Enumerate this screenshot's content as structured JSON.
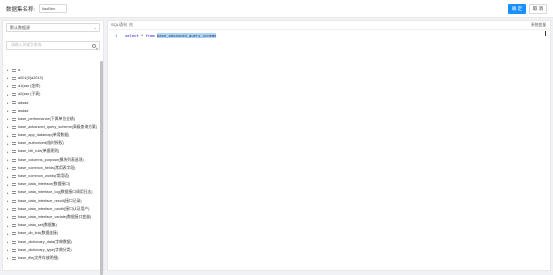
{
  "header": {
    "dataset_name_label": "数据集名称:",
    "dataset_name_value": "liaoBen",
    "confirm_label": "确 定",
    "cancel_label": "取 消"
  },
  "left_panel": {
    "database_select": "默认数据源",
    "search_placeholder": "请输入关键字查询",
    "tables": [
      "a",
      "a001(0)a2013)",
      "a1(sss (金库)",
      "a2(sss (子表)",
      "adsad",
      "asdad",
      "base_performance(下属单位业绩)",
      "base_advanced_query_scheme(高级查询方案)",
      "base_app_datamap(单用数据)",
      "base_authorized(临时授权)",
      "base_bill_rule(单据规则)",
      "base_columns_purpose(模块列表选项)",
      "base_common_fields(常用表字段)",
      "base_common_words(常用语)",
      "base_data_interface(数据接口)",
      "base_data_interface_log(数据接口调用日志)",
      "base_data_interface_result(接口记录)",
      "base_data_interface_oauth(接口认证用户)",
      "base_data_interface_variate(数据接口变量)",
      "base_data_set(数据集)",
      "base_db_link(数据连接)",
      "base_dictionary_data(字典数据)",
      "base_dictionary_type(字典分类)",
      "base_file(文件存放明细)"
    ]
  },
  "editor": {
    "title": "SQL语句",
    "format_label": "格",
    "options_label": "系统变量",
    "line_number": "1",
    "code_select": "select",
    "code_star": " * ",
    "code_from": "from",
    "code_table": "base_advanced_query_scheme"
  }
}
